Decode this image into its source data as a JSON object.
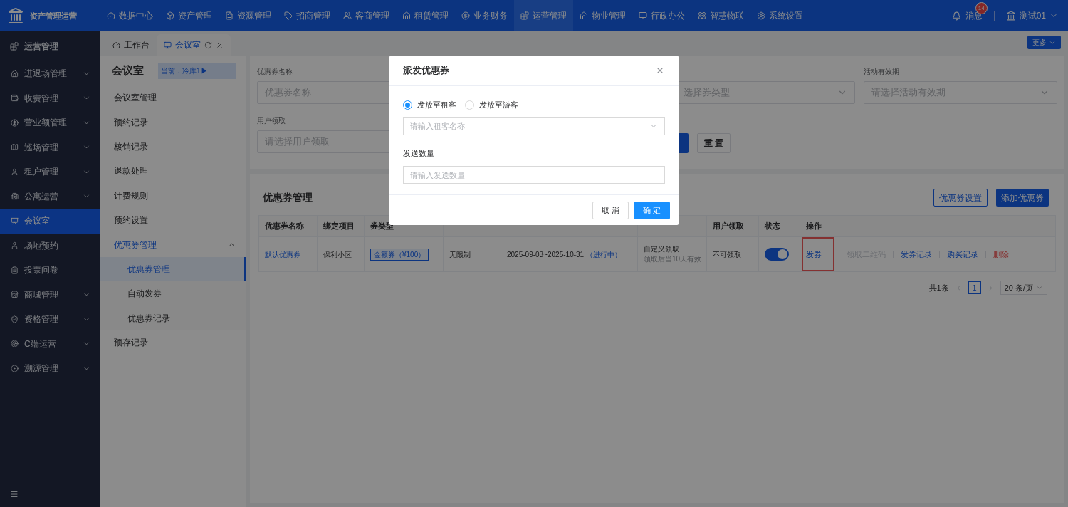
{
  "app": {
    "title": "资产管理运营"
  },
  "top_nav": [
    {
      "label": "数据中心",
      "selected": false
    },
    {
      "label": "资产管理",
      "selected": false
    },
    {
      "label": "资源管理",
      "selected": false
    },
    {
      "label": "招商管理",
      "selected": false
    },
    {
      "label": "客商管理",
      "selected": false
    },
    {
      "label": "租赁管理",
      "selected": false
    },
    {
      "label": "业务财务",
      "selected": false
    },
    {
      "label": "运营管理",
      "selected": true
    },
    {
      "label": "物业管理",
      "selected": false
    },
    {
      "label": "行政办公",
      "selected": false
    },
    {
      "label": "智慧物联",
      "selected": false
    },
    {
      "label": "系统设置",
      "selected": false
    }
  ],
  "notifications": {
    "label": "消息",
    "badge": "14"
  },
  "user": {
    "name": "测试01"
  },
  "sidebar": {
    "header": "运营管理",
    "items": [
      {
        "label": "进退场管理",
        "selected": false,
        "expandable": true
      },
      {
        "label": "收费管理",
        "selected": false,
        "expandable": true
      },
      {
        "label": "营业额管理",
        "selected": false,
        "expandable": true
      },
      {
        "label": "巡场管理",
        "selected": false,
        "expandable": true
      },
      {
        "label": "租户管理",
        "selected": false,
        "expandable": true
      },
      {
        "label": "公寓运营",
        "selected": false,
        "expandable": true
      },
      {
        "label": "会议室",
        "selected": true,
        "expandable": false
      },
      {
        "label": "场地预约",
        "selected": false,
        "expandable": false
      },
      {
        "label": "投票问卷",
        "selected": false,
        "expandable": false
      },
      {
        "label": "商城管理",
        "selected": false,
        "expandable": true
      },
      {
        "label": "资格管理",
        "selected": false,
        "expandable": true
      },
      {
        "label": "C端运营",
        "selected": false,
        "expandable": true
      },
      {
        "label": "溯源管理",
        "selected": false,
        "expandable": true
      }
    ]
  },
  "tabs": [
    {
      "label": "工作台",
      "selected": false
    },
    {
      "label": "会议室",
      "selected": true
    }
  ],
  "more_button": "更多",
  "submenu": {
    "title": "会议室",
    "current": "当前：冷库1▶",
    "items": [
      {
        "label": "会议室管理",
        "selected": false
      },
      {
        "label": "预约记录",
        "selected": false
      },
      {
        "label": "核销记录",
        "selected": false
      },
      {
        "label": "退款处理",
        "selected": false
      },
      {
        "label": "计费规则",
        "selected": false
      },
      {
        "label": "预约设置",
        "selected": false
      },
      {
        "label": "优惠券管理",
        "selected": false,
        "expanded": true,
        "children": [
          {
            "label": "优惠券管理",
            "selected": true
          },
          {
            "label": "自动发券",
            "selected": false
          },
          {
            "label": "优惠券记录",
            "selected": false
          }
        ]
      },
      {
        "label": "预存记录",
        "selected": false
      }
    ]
  },
  "filters": {
    "fields": [
      {
        "label": "优惠券名称",
        "placeholder": "优惠券名称",
        "kind": "input"
      },
      {
        "placeholder": "选择券类型",
        "kind": "select"
      },
      {
        "label": "活动有效期",
        "placeholder": "请选择活动有效期",
        "kind": "select"
      },
      {
        "label": "用户领取",
        "placeholder": "请选择用户领取",
        "kind": "input"
      }
    ],
    "reset_button": "重 置"
  },
  "coupons": {
    "title": "优惠券管理",
    "buttons": [
      {
        "label": "优惠券设置",
        "kind": "outline"
      },
      {
        "label": "添加优惠券",
        "kind": "primary"
      }
    ],
    "columns": [
      "优惠券名称",
      "绑定项目",
      "券类型",
      "用户领取",
      "状态",
      "操作"
    ],
    "rows": [
      {
        "name": "默认优惠券",
        "project": "保利小区",
        "type": "金额券（¥100）",
        "limit": "无限制",
        "period": "2025-09-03~2025-10-31",
        "period_status": "（进行中）",
        "claim": "自定义领取",
        "claim_note": "领取后当10天有效",
        "user_claim": "不可领取",
        "on": true,
        "actions": [
          {
            "label": "发券",
            "kind": "link",
            "highlighted": true
          },
          {
            "label": "领取二维码",
            "kind": "disabled",
            "highlighted": false
          },
          {
            "label": "发券记录",
            "kind": "link",
            "highlighted": false
          },
          {
            "label": "购买记录",
            "kind": "link",
            "highlighted": false
          },
          {
            "label": "删除",
            "kind": "danger",
            "highlighted": false
          }
        ]
      }
    ],
    "pagination": {
      "total": "共1条",
      "pages": [
        {
          "label": "1",
          "selected": true
        }
      ],
      "page_size": "20 条/页"
    }
  },
  "dialog": {
    "title": "派发优惠券",
    "options": [
      {
        "label": "发放至租客",
        "selected": true
      },
      {
        "label": "发放至游客",
        "selected": false
      }
    ],
    "tenant_placeholder": "请输入租客名称",
    "quantity_label": "发送数量",
    "quantity_placeholder": "请输入发送数量",
    "buttons": [
      {
        "label": "取 消",
        "kind": "default"
      },
      {
        "label": "确 定",
        "kind": "primary"
      }
    ]
  }
}
